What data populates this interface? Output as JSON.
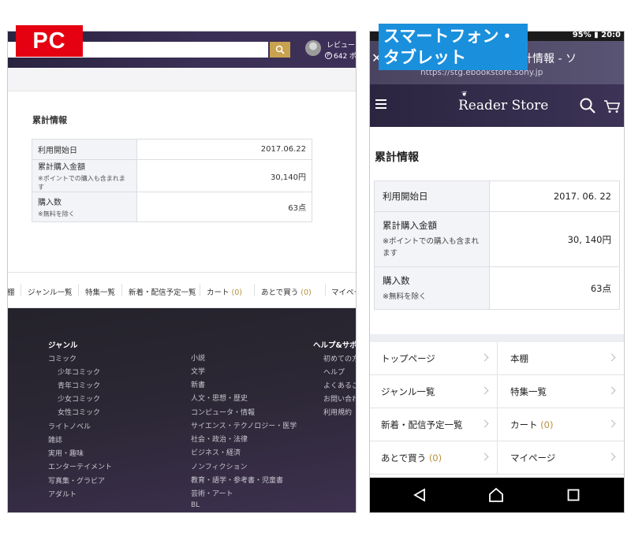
{
  "labels": {
    "pc": "PC",
    "smartphone_line1": "スマートフォン・",
    "smartphone_line2": "タブレット"
  },
  "pc": {
    "user": {
      "name": "レビュー",
      "points": "642 ポ"
    },
    "section_title": "累計情報",
    "rows": [
      {
        "label": "利用開始日",
        "note": "",
        "value": "2017.06.22"
      },
      {
        "label": "累計購入金額",
        "note": "※ポイントでの購入も含まれます",
        "value": "30,140円"
      },
      {
        "label": "購入数",
        "note": "※無料を除く",
        "value": "63点"
      }
    ],
    "nav": {
      "item0": "棚",
      "item1": "ジャンル一覧",
      "item2": "特集一覧",
      "item3": "新着・配信予定一覧",
      "item4": "カート",
      "item4_count": "(0)",
      "item5": "あとで買う",
      "item5_count": "(0)",
      "item6": "マイペー"
    },
    "footer": {
      "genre_heading": "ジャンル",
      "col1": [
        "コミック",
        "少年コミック",
        "青年コミック",
        "少女コミック",
        "女性コミック",
        "ライトノベル",
        "雑誌",
        "実用・趣味",
        "エンターテイメント",
        "写真集・グラビア",
        "アダルト"
      ],
      "col2": [
        "小説",
        "文学",
        "新書",
        "人文・思想・歴史",
        "コンピュータ・情報",
        "サイエンス・テクノロジー・医学",
        "社会・政治・法律",
        "ビジネス・経済",
        "ノンフィクション",
        "教育・語学・参考書・児童書",
        "芸術・アート",
        "BL"
      ],
      "help_heading": "ヘルプ&サポ",
      "col3": [
        "初めての方",
        "ヘルプ",
        "よくあるご",
        "お問い合わ",
        "利用規約"
      ]
    }
  },
  "sp": {
    "status_bar": "95% ▮ 20:0",
    "page_title": "計情報 - ソ",
    "url": "https://stg.ebookstore.sony.jp",
    "logo": "Reader Store",
    "section_title": "累計情報",
    "rows": [
      {
        "label": "利用開始日",
        "note": "",
        "value": "2017. 06. 22"
      },
      {
        "label": "累計購入金額",
        "note": "※ポイントでの購入も含まれます",
        "value": "30, 140円"
      },
      {
        "label": "購入数",
        "note": "※無料を除く",
        "value": "63点"
      }
    ],
    "nav": [
      {
        "label": "トップページ",
        "count": ""
      },
      {
        "label": "本棚",
        "count": ""
      },
      {
        "label": "ジャンル一覧",
        "count": ""
      },
      {
        "label": "特集一覧",
        "count": ""
      },
      {
        "label": "新着・配信予定一覧",
        "count": ""
      },
      {
        "label": "カート",
        "count": "(0)"
      },
      {
        "label": "あとで買う",
        "count": "(0)"
      },
      {
        "label": "マイページ",
        "count": ""
      }
    ]
  }
}
